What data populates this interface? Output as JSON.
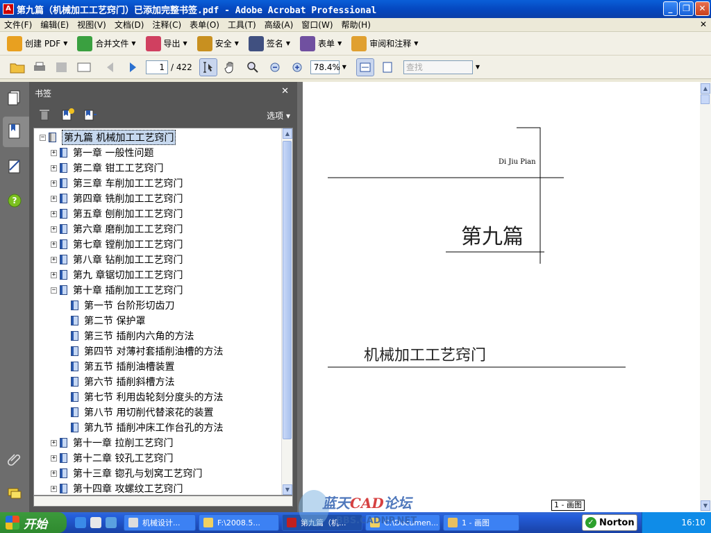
{
  "window": {
    "title": "第九篇（机械加工工艺窍门）已添加完整书签.pdf - Adobe Acrobat Professional",
    "app_icon": "pdf-icon"
  },
  "menubar": [
    "文件(F)",
    "编辑(E)",
    "视图(V)",
    "文档(D)",
    "注释(C)",
    "表单(O)",
    "工具(T)",
    "高级(A)",
    "窗口(W)",
    "帮助(H)"
  ],
  "toolbar1": [
    {
      "label": "创建 PDF",
      "icon": "create-pdf-icon",
      "color": "#e8a020"
    },
    {
      "label": "合并文件",
      "icon": "combine-files-icon",
      "color": "#3aa040"
    },
    {
      "label": "导出",
      "icon": "export-icon",
      "color": "#d04060"
    },
    {
      "label": "安全",
      "icon": "lock-icon",
      "color": "#c89020"
    },
    {
      "label": "签名",
      "icon": "pen-icon",
      "color": "#405080"
    },
    {
      "label": "表单",
      "icon": "form-icon",
      "color": "#7050a0"
    },
    {
      "label": "审阅和注释",
      "icon": "comment-icon",
      "color": "#e0a030"
    }
  ],
  "toolbar2": {
    "page_current": "1",
    "page_total": "/ 422",
    "zoom": "78.4%",
    "find_placeholder": "查找"
  },
  "bookmarks_panel": {
    "title": "书签",
    "options_label": "选项",
    "items": [
      {
        "label": "第九篇  机械加工工艺窍门",
        "level": 0,
        "expander": "−",
        "selected": true
      },
      {
        "label": "第一章  一般性问题",
        "level": 1,
        "expander": "+"
      },
      {
        "label": "第二章  钳工工艺窍门",
        "level": 1,
        "expander": "+"
      },
      {
        "label": "第三章  车削加工工艺窍门",
        "level": 1,
        "expander": "+"
      },
      {
        "label": "第四章  铣削加工工艺窍门",
        "level": 1,
        "expander": "+"
      },
      {
        "label": "第五章  刨削加工工艺窍门",
        "level": 1,
        "expander": "+"
      },
      {
        "label": "第六章  磨削加工工艺窍门",
        "level": 1,
        "expander": "+"
      },
      {
        "label": "第七章  镗削加工工艺窍门",
        "level": 1,
        "expander": "+"
      },
      {
        "label": "第八章  钻削加工工艺窍门",
        "level": 1,
        "expander": "+"
      },
      {
        "label": "第九  章锯切加工工艺窍门",
        "level": 1,
        "expander": "+"
      },
      {
        "label": "第十章  插削加工工艺窍门",
        "level": 1,
        "expander": "−"
      },
      {
        "label": "第一节  台阶形切齿刀",
        "level": 2,
        "expander": ""
      },
      {
        "label": "第二节  保护罩",
        "level": 2,
        "expander": ""
      },
      {
        "label": "第三节  插削内六角的方法",
        "level": 2,
        "expander": ""
      },
      {
        "label": "第四节  对薄衬套插削油槽的方法",
        "level": 2,
        "expander": ""
      },
      {
        "label": "第五节  插削油槽装置",
        "level": 2,
        "expander": ""
      },
      {
        "label": "第六节  插削斜槽方法",
        "level": 2,
        "expander": ""
      },
      {
        "label": "第七节  利用齿轮刻分度头的方法",
        "level": 2,
        "expander": ""
      },
      {
        "label": "第八节  用切削代替滚花的装置",
        "level": 2,
        "expander": ""
      },
      {
        "label": "第九节  插削冲床工作台孔的方法",
        "level": 2,
        "expander": ""
      },
      {
        "label": "第十一章  拉削工艺窍门",
        "level": 1,
        "expander": "+"
      },
      {
        "label": "第十二章  铰孔工艺窍门",
        "level": 1,
        "expander": "+"
      },
      {
        "label": "第十三章  锪孔与划窝工艺窍门",
        "level": 1,
        "expander": "+"
      },
      {
        "label": "第十四章  攻螺纹工艺窍门",
        "level": 1,
        "expander": "+"
      }
    ]
  },
  "document_page": {
    "pinyin": "Di Jiu Pian",
    "part_title": "第九篇",
    "subtitle": "机械加工工艺窍门",
    "page_label": "1 - 画图"
  },
  "watermark": {
    "text": "蓝天CAD论坛",
    "url_fragment": "BBS.CADNP.NET"
  },
  "taskbar": {
    "start_label": "开始",
    "tasks": [
      {
        "label": "机械设计...",
        "active": false
      },
      {
        "label": "F:\\2008.5...",
        "active": false
      },
      {
        "label": "第九篇（机...",
        "active": true
      },
      {
        "label": "C:\\Documen...",
        "active": false
      },
      {
        "label": "1 - 画图",
        "active": false
      }
    ],
    "norton": "Norton",
    "clock": "16:10"
  }
}
